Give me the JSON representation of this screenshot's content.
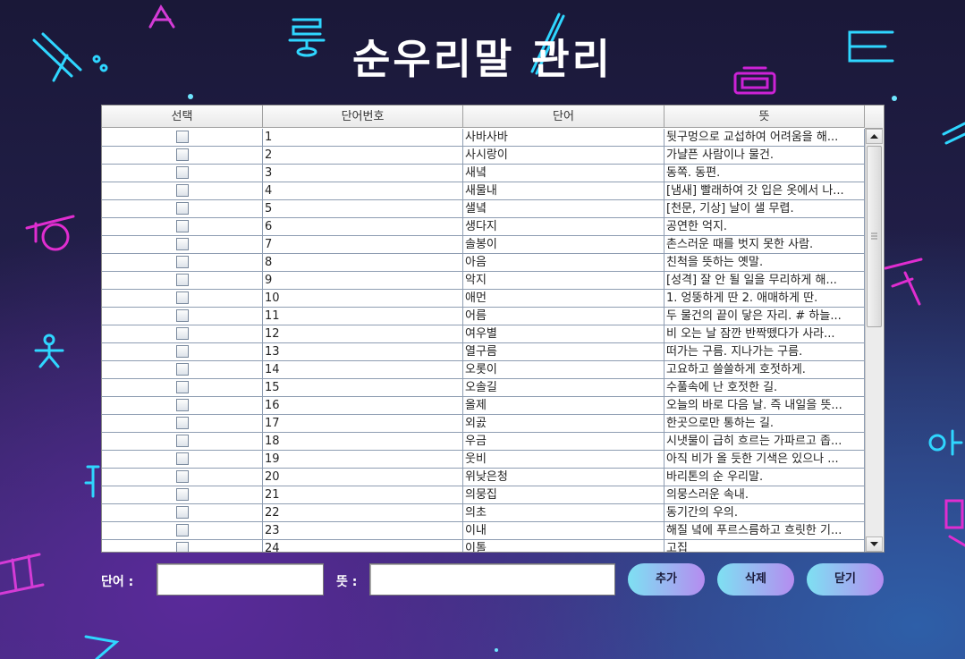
{
  "window": {
    "title": "순우리말 관리"
  },
  "table": {
    "headers": [
      "선택",
      "단어번호",
      "단어",
      "뜻"
    ],
    "rows": [
      {
        "no": "1",
        "word": "사바사바",
        "meaning": "뒷구멍으로 교섭하여 어려움을 해..."
      },
      {
        "no": "2",
        "word": "사시랑이",
        "meaning": "가냘픈 사람이나 물건."
      },
      {
        "no": "3",
        "word": "새녘",
        "meaning": "동쪽. 동편."
      },
      {
        "no": "4",
        "word": "새물내",
        "meaning": "[냄새] 빨래하여 갓 입은 옷에서 나..."
      },
      {
        "no": "5",
        "word": "샐녘",
        "meaning": "[천문, 기상] 날이 샐 무렵."
      },
      {
        "no": "6",
        "word": "생다지",
        "meaning": "공연한 억지."
      },
      {
        "no": "7",
        "word": "솔봉이",
        "meaning": "촌스러운 때를 벗지 못한 사람."
      },
      {
        "no": "8",
        "word": "아음",
        "meaning": "친척을 뜻하는 옛말."
      },
      {
        "no": "9",
        "word": "악지",
        "meaning": "[성격] 잘 안 될 일을 무리하게 해..."
      },
      {
        "no": "10",
        "word": "애먼",
        "meaning": "1. 엉뚱하게 딴 2. 애매하게 딴."
      },
      {
        "no": "11",
        "word": "어름",
        "meaning": "두 물건의 끝이 닿은 자리. # 하늘..."
      },
      {
        "no": "12",
        "word": "여우별",
        "meaning": "비 오는 날 잠깐 반짝뗐다가 사라..."
      },
      {
        "no": "13",
        "word": "열구름",
        "meaning": "떠가는 구름. 지나가는 구름."
      },
      {
        "no": "14",
        "word": "오롯이",
        "meaning": "고요하고 쓸쓸하게 호젓하게."
      },
      {
        "no": "15",
        "word": "오솔길",
        "meaning": "수풀속에 난 호젓한 길."
      },
      {
        "no": "16",
        "word": "올제",
        "meaning": "오늘의 바로 다음 날. 즉 내일을 뜻..."
      },
      {
        "no": "17",
        "word": "외곬",
        "meaning": "한곳으로만 통하는 길."
      },
      {
        "no": "18",
        "word": "우금",
        "meaning": "시냇물이 급히 흐르는 가파르고 좁..."
      },
      {
        "no": "19",
        "word": "웃비",
        "meaning": "아직 비가 올 듯한 기색은 있으나 ..."
      },
      {
        "no": "20",
        "word": "위낮은청",
        "meaning": "바리톤의 순 우리말."
      },
      {
        "no": "21",
        "word": "의뭉집",
        "meaning": "의뭉스러운 속내."
      },
      {
        "no": "22",
        "word": "의초",
        "meaning": "동기간의 우의."
      },
      {
        "no": "23",
        "word": "이내",
        "meaning": "해질 녘에 푸르스름하고 흐릿한 기..."
      },
      {
        "no": "24",
        "word": "이톨",
        "meaning": "고집"
      }
    ]
  },
  "form": {
    "word_label": "단어 :",
    "meaning_label": "뜻 :",
    "word_value": "",
    "meaning_value": ""
  },
  "buttons": {
    "add": "추가",
    "delete": "삭제",
    "close": "닫기"
  },
  "colors": {
    "accent_cyan": "#2fd6ff",
    "accent_magenta": "#d02bd6"
  }
}
